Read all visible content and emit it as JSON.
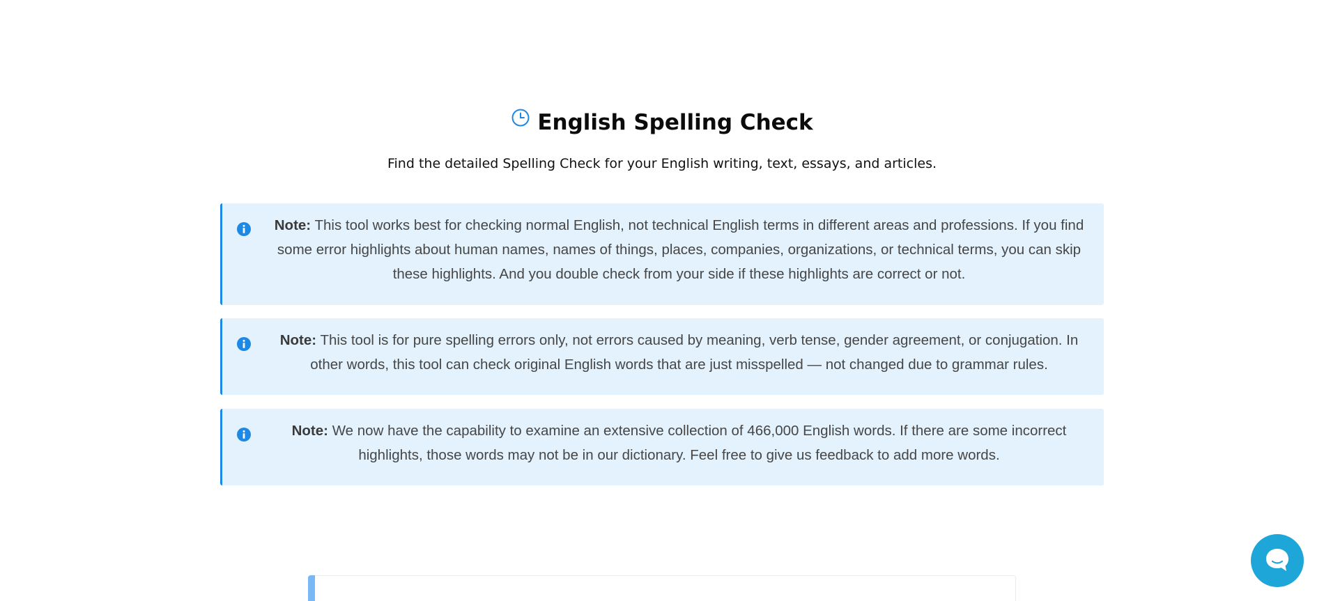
{
  "header": {
    "icon": "clock-icon",
    "title": "English Spelling Check",
    "subtitle": "Find the detailed Spelling Check for your English writing, text, essays, and articles."
  },
  "notes": [
    {
      "icon": "info-icon",
      "label": "Note:",
      "text": "This tool works best for checking normal English, not technical English terms in different areas and professions. If you find some error highlights about human names, names of things, places, companies, organizations, or technical terms, you can skip these highlights. And you double check from your side if these highlights are correct or not."
    },
    {
      "icon": "info-icon",
      "label": "Note:",
      "text": "This tool is for pure spelling errors only, not errors caused by meaning, verb tense, gender agreement, or conjugation. In other words, this tool can check original English words that are just misspelled — not changed due to grammar rules."
    },
    {
      "icon": "info-icon",
      "label": "Note:",
      "text": "We now have the capability to examine an extensive collection of 466,000 English words. If there are some incorrect highlights, those words may not be in our dictionary. Feel free to give us feedback to add more words."
    }
  ],
  "chat": {
    "icon": "chat-bubble-icon"
  },
  "colors": {
    "accent": "#1e88e5",
    "note_background": "#e3f2fd",
    "chat_button": "#1ea6d8"
  }
}
